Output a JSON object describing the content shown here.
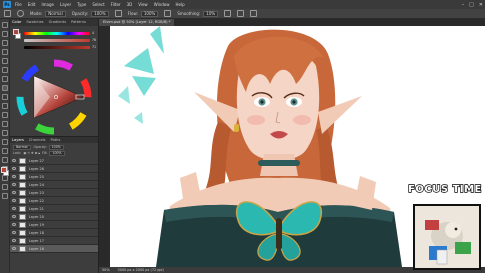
{
  "menu": {
    "app_logo": "Ps",
    "items": [
      "File",
      "Edit",
      "Image",
      "Layer",
      "Type",
      "Select",
      "Filter",
      "3D",
      "View",
      "Window",
      "Help"
    ],
    "window_controls": [
      "–",
      "□",
      "✕"
    ]
  },
  "options": {
    "mode_label": "Mode:",
    "mode_value": "Normal",
    "opacity_label": "Opacity:",
    "opacity_value": "100%",
    "flow_label": "Flow:",
    "flow_value": "100%",
    "smoothing_label": "Smoothing:",
    "smoothing_value": "10%"
  },
  "left_panel": {
    "color_tabs": [
      "Color",
      "Swatches",
      "Gradients",
      "Patterns"
    ],
    "slider_values": [
      "4",
      "76",
      "71"
    ],
    "layer_tabs": [
      "Layers",
      "Channels",
      "Paths"
    ],
    "blend_mode": "Normal",
    "opacity_label": "Opacity:",
    "opacity_value": "100%",
    "lock_label": "Lock:",
    "fill_label": "Fill:",
    "fill_value": "100%",
    "layers": [
      {
        "name": "Layer 27"
      },
      {
        "name": "Layer 26"
      },
      {
        "name": "Layer 25"
      },
      {
        "name": "Layer 24"
      },
      {
        "name": "Layer 23"
      },
      {
        "name": "Layer 22"
      },
      {
        "name": "Layer 21"
      },
      {
        "name": "Layer 20"
      },
      {
        "name": "Layer 19"
      },
      {
        "name": "Layer 18"
      },
      {
        "name": "Layer 17"
      },
      {
        "name": "Layer 16"
      }
    ]
  },
  "document": {
    "tab_title": "Elven.psd @ 50% (Layer 12, RGB/8) *",
    "zoom": "50%",
    "info": "3000 px x 2000 px (72 ppi)"
  },
  "overlay": {
    "title": "FOCUS TIME"
  },
  "colors": {
    "foreground": "#b5443b",
    "background": "#ffffff",
    "hair": "#c8683a",
    "butterfly": "#2bb8b0"
  }
}
